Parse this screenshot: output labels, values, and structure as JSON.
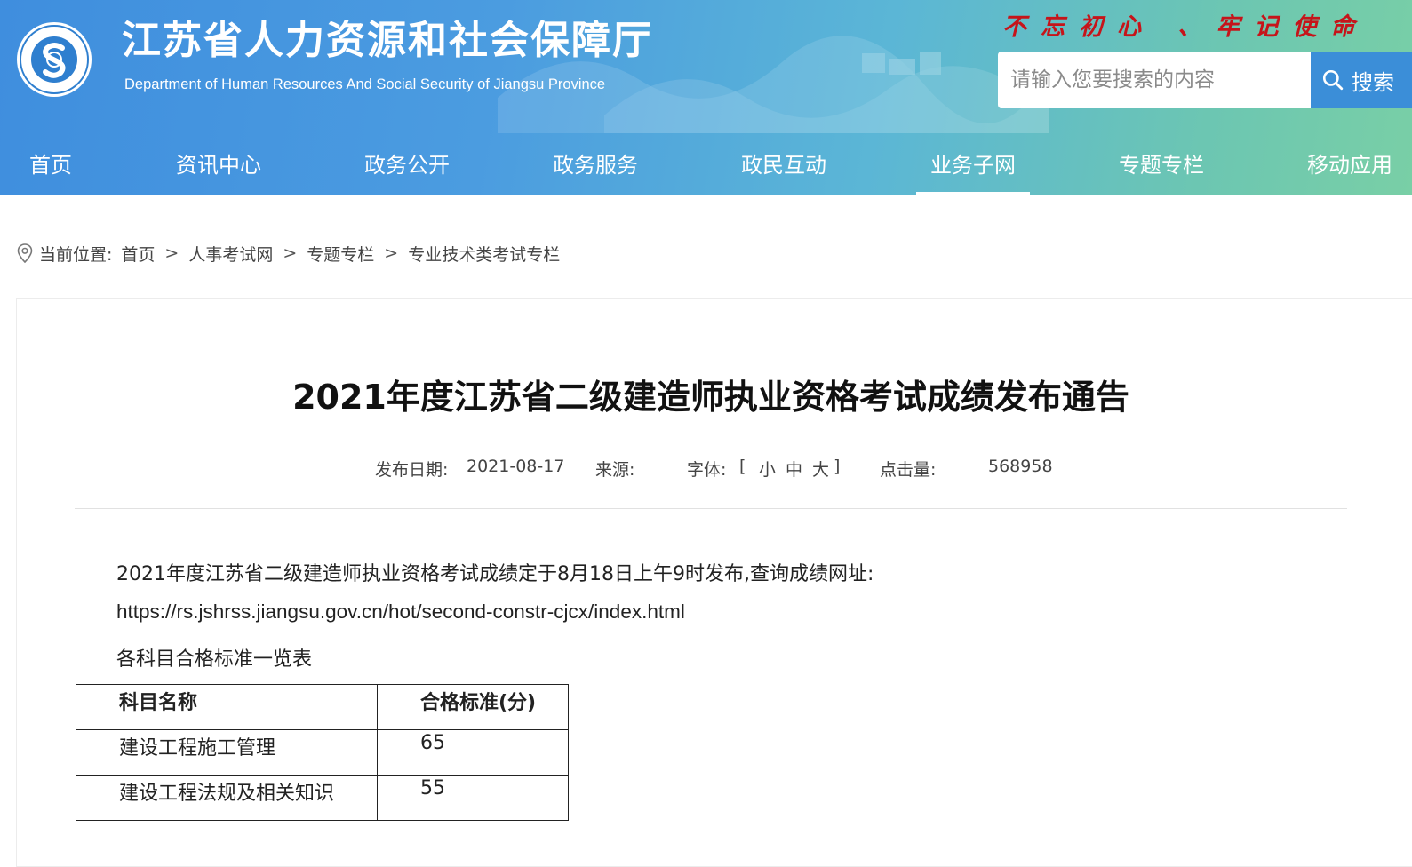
{
  "header": {
    "site_title": "江苏省人力资源和社会保障厅",
    "site_subtitle": "Department of Human Resources And Social Security of Jiangsu Province",
    "slogan": "不忘初心 、牢记使命",
    "logo_text": "江苏省人力资源和社会保障厅",
    "search_placeholder": "请输入您要搜索的内容",
    "search_button": "搜索"
  },
  "nav": [
    {
      "label": "首页",
      "active": false
    },
    {
      "label": "资讯中心",
      "active": false
    },
    {
      "label": "政务公开",
      "active": false
    },
    {
      "label": "政务服务",
      "active": false
    },
    {
      "label": "政民互动",
      "active": false
    },
    {
      "label": "业务子网",
      "active": true
    },
    {
      "label": "专题专栏",
      "active": false
    },
    {
      "label": "移动应用",
      "active": false
    }
  ],
  "breadcrumb": {
    "prefix": "当前位置:",
    "items": [
      "首页",
      "人事考试网",
      "专题专栏",
      "专业技术类考试专栏"
    ],
    "separator": ">"
  },
  "article": {
    "title": "2021年度江苏省二级建造师执业资格考试成绩发布通告",
    "meta": {
      "date_label": "发布日期:",
      "date": "2021-08-17",
      "source_label": "来源:",
      "font_label": "字体:",
      "font_open": "[",
      "font_small": "小",
      "font_medium": "中",
      "font_large": "大",
      "font_close": "]",
      "hits_label": "点击量:",
      "hits": "568958"
    },
    "paragraph1": "2021年度江苏省二级建造师执业资格考试成绩定于8月18日上午9时发布,查询成绩网址:",
    "url": "https://rs.jshrss.jiangsu.gov.cn/hot/second-constr-cjcx/index.html",
    "table_caption": "各科目合格标准一览表",
    "table": {
      "headers": [
        "科目名称",
        "合格标准(分)"
      ],
      "rows": [
        [
          "建设工程施工管理",
          "65"
        ],
        [
          "建设工程法规及相关知识",
          "55"
        ]
      ]
    }
  },
  "colors": {
    "header_start": "#3f8ede",
    "header_end": "#79cfa6",
    "slogan": "#c6141a",
    "search_button": "#3b8ed8"
  }
}
